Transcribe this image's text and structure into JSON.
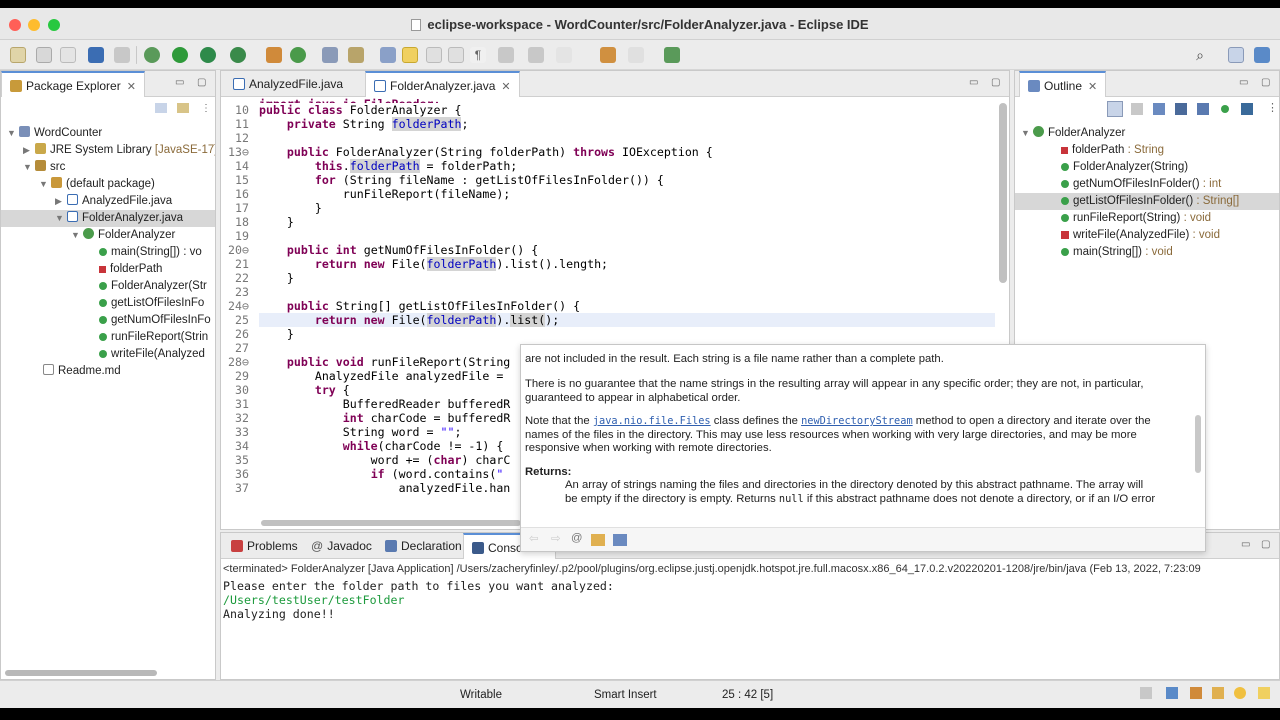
{
  "window": {
    "title": "eclipse-workspace - WordCounter/src/FolderAnalyzer.java - Eclipse IDE"
  },
  "package_explorer": {
    "tab_label": "Package Explorer",
    "tree": [
      {
        "label": "WordCounter",
        "icon": "project-icon"
      },
      {
        "label": "JRE System Library",
        "suffix": "[JavaSE-17]",
        "icon": "library-icon"
      },
      {
        "label": "src",
        "icon": "source-folder-icon"
      },
      {
        "label": "(default package)",
        "icon": "package-icon"
      },
      {
        "label": "AnalyzedFile.java",
        "icon": "java-file-icon"
      },
      {
        "label": "FolderAnalyzer.java",
        "icon": "java-file-icon"
      },
      {
        "label": "FolderAnalyzer",
        "icon": "class-icon"
      },
      {
        "label": "main(String[]) : vo",
        "icon": "method-icon"
      },
      {
        "label": "folderPath",
        "icon": "field-icon"
      },
      {
        "label": "FolderAnalyzer(Str",
        "icon": "constructor-icon"
      },
      {
        "label": "getListOfFilesInFo",
        "icon": "method-icon"
      },
      {
        "label": "getNumOfFilesInFo",
        "icon": "method-icon"
      },
      {
        "label": "runFileReport(Strin",
        "icon": "method-icon"
      },
      {
        "label": "writeFile(Analyzed",
        "icon": "method-icon"
      },
      {
        "label": "Readme.md",
        "icon": "markdown-file-icon"
      }
    ]
  },
  "editor": {
    "tabs": [
      {
        "label": "AnalyzedFile.java"
      },
      {
        "label": "FolderAnalyzer.java"
      }
    ],
    "cursor_line": "25"
  },
  "hover_doc": {
    "line1": "are not included in the result. Each string is a file name rather than a complete path.",
    "para2": "There is no guarantee that the name strings in the resulting array will appear in any specific order; they are not, in particular,",
    "para2b": "guaranteed to appear in alphabetical order.",
    "note_a": "Note that the",
    "note_link1": "java.nio.file.Files",
    "note_b": "class defines the",
    "note_link2": "newDirectoryStream",
    "note_c": "method to open a directory and iterate over the",
    "note_line2": "names of the files in the directory. This may use less resources when working with very large directories, and may be more",
    "note_line3": "responsive when working with remote directories.",
    "returns_label": "Returns:",
    "returns_1": "An array of strings naming the files and directories in the directory denoted by this abstract pathname. The array will",
    "returns_2a": "be empty if the directory is empty. Returns",
    "returns_2_null": "null",
    "returns_2b": "if this abstract pathname does not denote a directory, or if an I/O error"
  },
  "outline": {
    "tab_label": "Outline",
    "items": [
      {
        "label": "FolderAnalyzer",
        "icon": "class-icon"
      },
      {
        "label": "folderPath",
        "type": ": String",
        "icon": "field-icon"
      },
      {
        "label": "FolderAnalyzer(String)",
        "type": "",
        "icon": "constructor-icon"
      },
      {
        "label": "getNumOfFilesInFolder()",
        "type": ": int",
        "icon": "method-icon"
      },
      {
        "label": "getListOfFilesInFolder()",
        "type": ": String[]",
        "icon": "method-icon"
      },
      {
        "label": "runFileReport(String)",
        "type": ": void",
        "icon": "method-icon"
      },
      {
        "label": "writeFile(AnalyzedFile)",
        "type": ": void",
        "icon": "private-method-icon"
      },
      {
        "label": "main(String[])",
        "type": ": void",
        "icon": "static-method-icon"
      }
    ]
  },
  "bottom_tabs": [
    {
      "label": "Problems"
    },
    {
      "label": "Javadoc"
    },
    {
      "label": "Declaration"
    },
    {
      "label": "Console"
    }
  ],
  "console": {
    "header": "<terminated> FolderAnalyzer [Java Application] /Users/zacheryfinley/.p2/pool/plugins/org.eclipse.justj.openjdk.hotspot.jre.full.macosx.x86_64_17.0.2.v20220201-1208/jre/bin/java  (Feb 13, 2022, 7:23:09",
    "lines": [
      {
        "text": "Please enter the folder path to files you want analyzed:",
        "color": "#000000"
      },
      {
        "text": "/Users/testUser/testFolder",
        "color": "#1c9a3c"
      },
      {
        "text": "Analyzing done!!",
        "color": "#000000"
      }
    ]
  },
  "status_bar": {
    "mode": "Writable",
    "insert": "Smart Insert",
    "position": "25 : 42 [5]"
  }
}
